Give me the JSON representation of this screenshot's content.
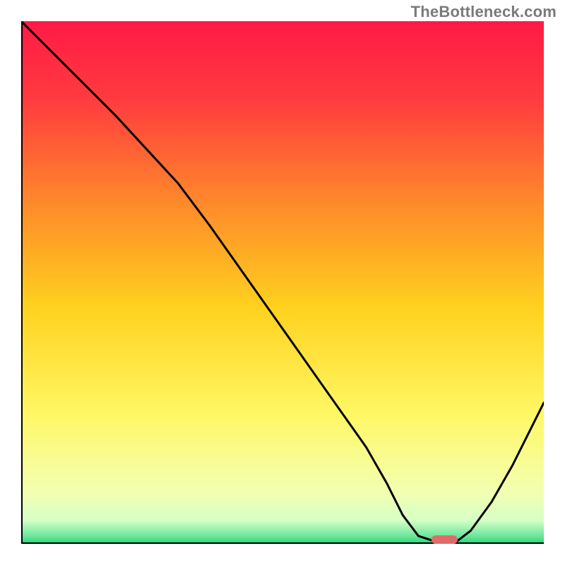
{
  "watermark": "TheBottleneck.com",
  "chart_data": {
    "type": "line",
    "title": "",
    "xlabel": "",
    "ylabel": "",
    "xlim": [
      0,
      100
    ],
    "ylim": [
      0,
      100
    ],
    "grid": false,
    "legend": false,
    "background_gradient": {
      "direction": "vertical",
      "stops": [
        {
          "offset": 0.0,
          "color": "#ff1a46"
        },
        {
          "offset": 0.15,
          "color": "#ff3b3f"
        },
        {
          "offset": 0.35,
          "color": "#ff8a2a"
        },
        {
          "offset": 0.55,
          "color": "#ffd21f"
        },
        {
          "offset": 0.75,
          "color": "#fff764"
        },
        {
          "offset": 0.9,
          "color": "#f3ffb0"
        },
        {
          "offset": 0.955,
          "color": "#d6ffc6"
        },
        {
          "offset": 0.985,
          "color": "#6de69c"
        },
        {
          "offset": 1.0,
          "color": "#1fd873"
        }
      ]
    },
    "series": [
      {
        "name": "curve",
        "type": "line",
        "x": [
          0.0,
          6.0,
          12.0,
          18.0,
          24.0,
          30.0,
          36.0,
          42.0,
          48.0,
          54.0,
          60.0,
          66.0,
          70.0,
          73.0,
          76.0,
          80.0,
          83.0,
          86.0,
          90.0,
          94.0,
          98.0,
          100.0
        ],
        "y": [
          100.0,
          94.0,
          88.0,
          82.0,
          75.5,
          69.0,
          61.0,
          52.5,
          44.0,
          35.5,
          27.0,
          18.5,
          11.5,
          5.5,
          1.5,
          0.2,
          0.2,
          2.5,
          8.0,
          15.0,
          23.0,
          27.0
        ]
      },
      {
        "name": "optimal-marker",
        "type": "marker",
        "shape": "pill",
        "x": [
          78.5,
          83.5
        ],
        "y": [
          0.8,
          0.8
        ],
        "color": "#e06a6a"
      }
    ],
    "axes_color": "#000000"
  },
  "colors": {
    "curve": "#000000",
    "marker": "#e06a6a",
    "axis": "#000000",
    "watermark": "#7a7a7a"
  }
}
